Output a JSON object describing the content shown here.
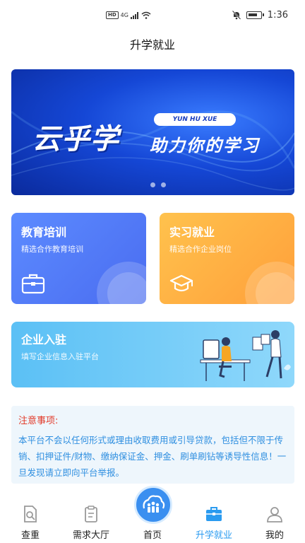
{
  "status_bar": {
    "hd": "HD",
    "signal": "4G",
    "time": "1:36"
  },
  "page_title": "升学就业",
  "banner": {
    "main_text": "云乎学",
    "pill_text": "YUN HU XUE",
    "sub_text": "助力你的学习"
  },
  "cards": {
    "education": {
      "title": "教育培训",
      "subtitle": "精选合作教育培训",
      "icon": "briefcase-icon"
    },
    "internship": {
      "title": "实习就业",
      "subtitle": "精选合作企业岗位",
      "icon": "graduation-cap-icon"
    },
    "enterprise": {
      "title": "企业入驻",
      "subtitle": "填写企业信息入驻平台"
    }
  },
  "notice": {
    "title": "注意事项:",
    "body": "本平台不会以任何形式或理由收取费用或引导贷款，包括但不限于传销、扣押证件/财物、缴纳保证金、押金、刷单刷钻等诱导性信息！一旦发现请立即向平台举报。"
  },
  "tabs": [
    {
      "label": "查重",
      "icon": "document-search-icon"
    },
    {
      "label": "需求大厅",
      "icon": "clipboard-icon"
    },
    {
      "label": "首页",
      "icon": "home-people-icon"
    },
    {
      "label": "升学就业",
      "icon": "briefcase-icon"
    },
    {
      "label": "我的",
      "icon": "user-icon"
    }
  ],
  "colors": {
    "accent": "#2a9bf0",
    "notice_title": "#e23b2a",
    "notice_body": "#2f8fe0"
  }
}
